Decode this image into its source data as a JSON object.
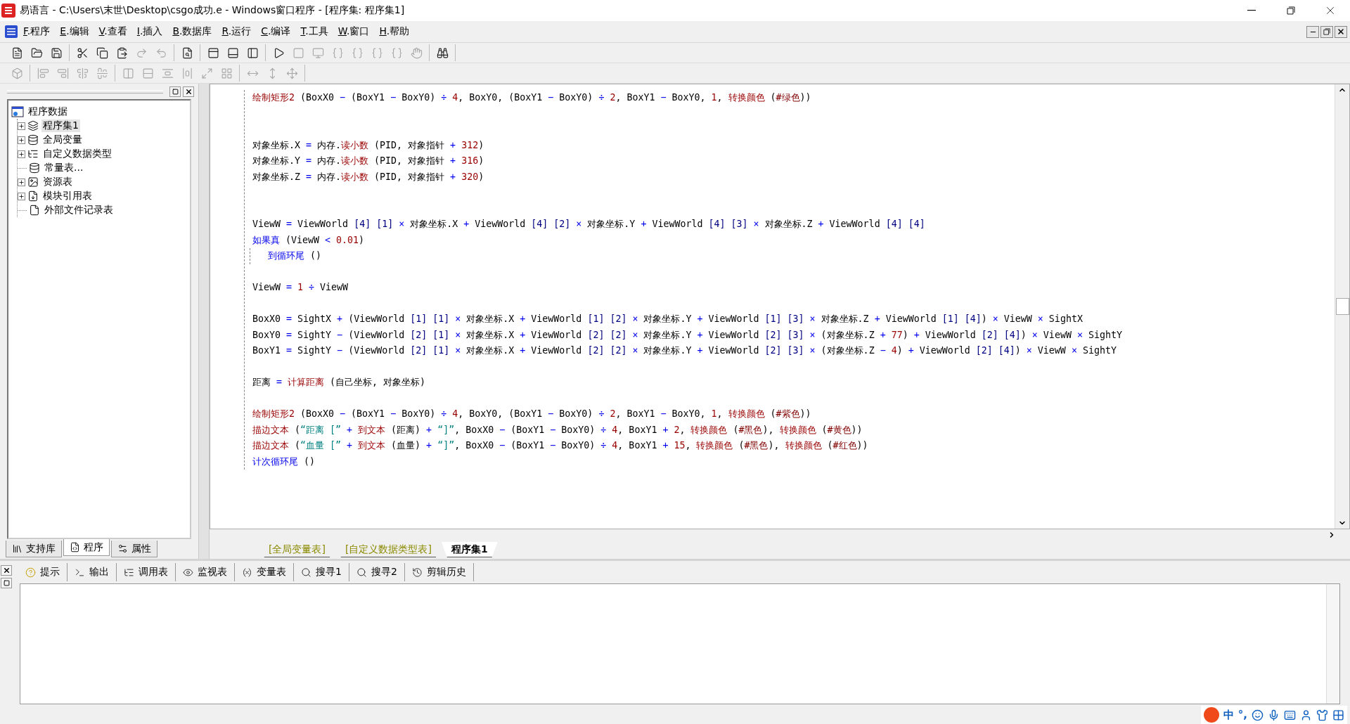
{
  "window": {
    "title": "易语言 - C:\\Users\\末世\\Desktop\\csgo成功.e - Windows窗口程序 - [程序集: 程序集1]"
  },
  "menu": [
    {
      "label": "F.程序"
    },
    {
      "label": "E.编辑"
    },
    {
      "label": "V.查看"
    },
    {
      "label": "I.插入"
    },
    {
      "label": "B.数据库"
    },
    {
      "label": "R.运行"
    },
    {
      "label": "C.编译"
    },
    {
      "label": "T.工具"
    },
    {
      "label": "W.窗口"
    },
    {
      "label": "H.帮助"
    }
  ],
  "toolbar_1": [
    {
      "buttons": [
        {
          "disabled": false
        },
        {
          "disabled": false
        },
        {
          "disabled": false
        }
      ]
    },
    {
      "buttons": [
        {
          "disabled": false
        },
        {
          "disabled": false
        },
        {
          "disabled": false
        },
        {
          "disabled": true
        },
        {
          "disabled": true
        }
      ]
    },
    {
      "buttons": [
        {
          "disabled": false
        }
      ]
    },
    {
      "buttons": [
        {
          "disabled": false
        },
        {
          "disabled": false
        },
        {
          "disabled": false
        }
      ]
    },
    {
      "buttons": [
        {
          "disabled": false
        },
        {
          "disabled": true
        },
        {
          "disabled": true
        },
        {
          "disabled": true
        },
        {
          "disabled": true
        },
        {
          "disabled": true
        },
        {
          "disabled": true
        },
        {
          "disabled": true
        }
      ]
    },
    {
      "buttons": [
        {
          "disabled": false
        }
      ]
    }
  ],
  "toolbar_2": [
    {
      "buttons": [
        {
          "disabled": true
        }
      ]
    },
    {
      "buttons": [
        {
          "disabled": true
        },
        {
          "disabled": true
        },
        {
          "disabled": true
        },
        {
          "disabled": true
        }
      ]
    },
    {
      "buttons": [
        {
          "disabled": true
        },
        {
          "disabled": true
        },
        {
          "disabled": true
        },
        {
          "disabled": true
        },
        {
          "disabled": true
        },
        {
          "disabled": true
        }
      ]
    },
    {
      "buttons": [
        {
          "disabled": true
        },
        {
          "disabled": true
        },
        {
          "disabled": true
        }
      ]
    }
  ],
  "tree": {
    "label": "程序数据",
    "children": [
      {
        "label": "程序集1",
        "expandable": true,
        "selected": true
      },
      {
        "label": "全局变量",
        "expandable": true,
        "selected": false
      },
      {
        "label": "自定义数据类型",
        "expandable": true,
        "selected": false
      },
      {
        "label": "常量表...",
        "expandable": false,
        "selected": false
      },
      {
        "label": "资源表",
        "expandable": true,
        "selected": false
      },
      {
        "label": "模块引用表",
        "expandable": true,
        "selected": false
      },
      {
        "label": "外部文件记录表",
        "expandable": false,
        "selected": false
      }
    ]
  },
  "left_tabs": [
    {
      "label": "支持库",
      "selected": false
    },
    {
      "label": "程序",
      "selected": true
    },
    {
      "label": "属性",
      "selected": false
    }
  ],
  "code": [
    {
      "kind": "code",
      "segs": [
        {
          "kind": "fn",
          "t": "绘制矩形2"
        },
        {
          "kind": "plain",
          "t": " (BoxX0 "
        },
        {
          "kind": "op",
          "t": "−"
        },
        {
          "kind": "plain",
          "t": " (BoxY1 "
        },
        {
          "kind": "op",
          "t": "−"
        },
        {
          "kind": "plain",
          "t": " BoxY0) "
        },
        {
          "kind": "op",
          "t": "÷"
        },
        {
          "kind": "num",
          "t": " 4"
        },
        {
          "kind": "plain",
          "t": ", BoxY0, (BoxY1 "
        },
        {
          "kind": "op",
          "t": "−"
        },
        {
          "kind": "plain",
          "t": " BoxY0) "
        },
        {
          "kind": "op",
          "t": "÷"
        },
        {
          "kind": "num",
          "t": " 2"
        },
        {
          "kind": "plain",
          "t": ", BoxY1 "
        },
        {
          "kind": "op",
          "t": "−"
        },
        {
          "kind": "plain",
          "t": " BoxY0, "
        },
        {
          "kind": "num",
          "t": "1"
        },
        {
          "kind": "plain",
          "t": ", "
        },
        {
          "kind": "fn",
          "t": "转换颜色"
        },
        {
          "kind": "plain",
          "t": " ("
        },
        {
          "kind": "const",
          "t": "#绿色"
        },
        {
          "kind": "plain",
          "t": "))"
        }
      ]
    },
    {
      "kind": "blank"
    },
    {
      "kind": "blank"
    },
    {
      "kind": "code",
      "segs": [
        {
          "kind": "plain",
          "t": "对象坐标.X "
        },
        {
          "kind": "op",
          "t": "="
        },
        {
          "kind": "plain",
          "t": " 内存."
        },
        {
          "kind": "fn",
          "t": "读小数"
        },
        {
          "kind": "plain",
          "t": " (PID, 对象指针 "
        },
        {
          "kind": "op",
          "t": "+"
        },
        {
          "kind": "num",
          "t": " 312"
        },
        {
          "kind": "plain",
          "t": ")"
        }
      ]
    },
    {
      "kind": "code",
      "segs": [
        {
          "kind": "plain",
          "t": "对象坐标.Y "
        },
        {
          "kind": "op",
          "t": "="
        },
        {
          "kind": "plain",
          "t": " 内存."
        },
        {
          "kind": "fn",
          "t": "读小数"
        },
        {
          "kind": "plain",
          "t": " (PID, 对象指针 "
        },
        {
          "kind": "op",
          "t": "+"
        },
        {
          "kind": "num",
          "t": " 316"
        },
        {
          "kind": "plain",
          "t": ")"
        }
      ]
    },
    {
      "kind": "code",
      "segs": [
        {
          "kind": "plain",
          "t": "对象坐标.Z "
        },
        {
          "kind": "op",
          "t": "="
        },
        {
          "kind": "plain",
          "t": " 内存."
        },
        {
          "kind": "fn",
          "t": "读小数"
        },
        {
          "kind": "plain",
          "t": " (PID, 对象指针 "
        },
        {
          "kind": "op",
          "t": "+"
        },
        {
          "kind": "num",
          "t": " 320"
        },
        {
          "kind": "plain",
          "t": ")"
        }
      ]
    },
    {
      "kind": "blank"
    },
    {
      "kind": "blank"
    },
    {
      "kind": "code",
      "segs": [
        {
          "kind": "plain",
          "t": "ViewW "
        },
        {
          "kind": "op",
          "t": "="
        },
        {
          "kind": "plain",
          "t": " ViewWorld "
        },
        {
          "kind": "idx",
          "t": "[4] [1]"
        },
        {
          "kind": "op",
          "t": " ×"
        },
        {
          "kind": "plain",
          "t": " 对象坐标.X "
        },
        {
          "kind": "op",
          "t": "+"
        },
        {
          "kind": "plain",
          "t": " ViewWorld "
        },
        {
          "kind": "idx",
          "t": "[4] [2]"
        },
        {
          "kind": "op",
          "t": " ×"
        },
        {
          "kind": "plain",
          "t": " 对象坐标.Y "
        },
        {
          "kind": "op",
          "t": "+"
        },
        {
          "kind": "plain",
          "t": " ViewWorld "
        },
        {
          "kind": "idx",
          "t": "[4] [3]"
        },
        {
          "kind": "op",
          "t": " ×"
        },
        {
          "kind": "plain",
          "t": " 对象坐标.Z "
        },
        {
          "kind": "op",
          "t": "+"
        },
        {
          "kind": "plain",
          "t": " ViewWorld "
        },
        {
          "kind": "idx",
          "t": "[4] [4]"
        }
      ]
    },
    {
      "kind": "branch",
      "segs": [
        {
          "kind": "kw",
          "t": "如果真"
        },
        {
          "kind": "plain",
          "t": " (ViewW "
        },
        {
          "kind": "op",
          "t": "<"
        },
        {
          "kind": "num",
          "t": " 0.01"
        },
        {
          "kind": "plain",
          "t": ")"
        }
      ],
      "children": [
        {
          "kind": "code",
          "segs": [
            {
              "kind": "kw",
              "t": "到循环尾"
            },
            {
              "kind": "plain",
              "t": " ()"
            }
          ]
        }
      ]
    },
    {
      "kind": "blank"
    },
    {
      "kind": "code",
      "segs": [
        {
          "kind": "plain",
          "t": "ViewW "
        },
        {
          "kind": "op",
          "t": "="
        },
        {
          "kind": "num",
          "t": " 1"
        },
        {
          "kind": "op",
          "t": " ÷"
        },
        {
          "kind": "plain",
          "t": " ViewW"
        }
      ]
    },
    {
      "kind": "blank"
    },
    {
      "kind": "code",
      "segs": [
        {
          "kind": "plain",
          "t": "BoxX0 "
        },
        {
          "kind": "op",
          "t": "="
        },
        {
          "kind": "plain",
          "t": " SightX "
        },
        {
          "kind": "op",
          "t": "+"
        },
        {
          "kind": "plain",
          "t": " (ViewWorld "
        },
        {
          "kind": "idx",
          "t": "[1] [1]"
        },
        {
          "kind": "op",
          "t": " ×"
        },
        {
          "kind": "plain",
          "t": " 对象坐标.X "
        },
        {
          "kind": "op",
          "t": "+"
        },
        {
          "kind": "plain",
          "t": " ViewWorld "
        },
        {
          "kind": "idx",
          "t": "[1] [2]"
        },
        {
          "kind": "op",
          "t": " ×"
        },
        {
          "kind": "plain",
          "t": " 对象坐标.Y "
        },
        {
          "kind": "op",
          "t": "+"
        },
        {
          "kind": "plain",
          "t": " ViewWorld "
        },
        {
          "kind": "idx",
          "t": "[1] [3]"
        },
        {
          "kind": "op",
          "t": " ×"
        },
        {
          "kind": "plain",
          "t": " 对象坐标.Z "
        },
        {
          "kind": "op",
          "t": "+"
        },
        {
          "kind": "plain",
          "t": " ViewWorld "
        },
        {
          "kind": "idx",
          "t": "[1] [4]"
        },
        {
          "kind": "plain",
          "t": ") "
        },
        {
          "kind": "op",
          "t": "×"
        },
        {
          "kind": "plain",
          "t": " ViewW "
        },
        {
          "kind": "op",
          "t": "×"
        },
        {
          "kind": "plain",
          "t": " SightX"
        }
      ]
    },
    {
      "kind": "code",
      "segs": [
        {
          "kind": "plain",
          "t": "BoxY0 "
        },
        {
          "kind": "op",
          "t": "="
        },
        {
          "kind": "plain",
          "t": " SightY "
        },
        {
          "kind": "op",
          "t": "−"
        },
        {
          "kind": "plain",
          "t": " (ViewWorld "
        },
        {
          "kind": "idx",
          "t": "[2] [1]"
        },
        {
          "kind": "op",
          "t": " ×"
        },
        {
          "kind": "plain",
          "t": " 对象坐标.X "
        },
        {
          "kind": "op",
          "t": "+"
        },
        {
          "kind": "plain",
          "t": " ViewWorld "
        },
        {
          "kind": "idx",
          "t": "[2] [2]"
        },
        {
          "kind": "op",
          "t": " ×"
        },
        {
          "kind": "plain",
          "t": " 对象坐标.Y "
        },
        {
          "kind": "op",
          "t": "+"
        },
        {
          "kind": "plain",
          "t": " ViewWorld "
        },
        {
          "kind": "idx",
          "t": "[2] [3]"
        },
        {
          "kind": "op",
          "t": " ×"
        },
        {
          "kind": "plain",
          "t": " (对象坐标.Z "
        },
        {
          "kind": "op",
          "t": "+"
        },
        {
          "kind": "num",
          "t": " 77"
        },
        {
          "kind": "plain",
          "t": ") "
        },
        {
          "kind": "op",
          "t": "+"
        },
        {
          "kind": "plain",
          "t": " ViewWorld "
        },
        {
          "kind": "idx",
          "t": "[2] [4]"
        },
        {
          "kind": "plain",
          "t": ") "
        },
        {
          "kind": "op",
          "t": "×"
        },
        {
          "kind": "plain",
          "t": " ViewW "
        },
        {
          "kind": "op",
          "t": "×"
        },
        {
          "kind": "plain",
          "t": " SightY"
        }
      ]
    },
    {
      "kind": "code",
      "segs": [
        {
          "kind": "plain",
          "t": "BoxY1 "
        },
        {
          "kind": "op",
          "t": "="
        },
        {
          "kind": "plain",
          "t": " SightY "
        },
        {
          "kind": "op",
          "t": "−"
        },
        {
          "kind": "plain",
          "t": " (ViewWorld "
        },
        {
          "kind": "idx",
          "t": "[2] [1]"
        },
        {
          "kind": "op",
          "t": " ×"
        },
        {
          "kind": "plain",
          "t": " 对象坐标.X "
        },
        {
          "kind": "op",
          "t": "+"
        },
        {
          "kind": "plain",
          "t": " ViewWorld "
        },
        {
          "kind": "idx",
          "t": "[2] [2]"
        },
        {
          "kind": "op",
          "t": " ×"
        },
        {
          "kind": "plain",
          "t": " 对象坐标.Y "
        },
        {
          "kind": "op",
          "t": "+"
        },
        {
          "kind": "plain",
          "t": " ViewWorld "
        },
        {
          "kind": "idx",
          "t": "[2] [3]"
        },
        {
          "kind": "op",
          "t": " ×"
        },
        {
          "kind": "plain",
          "t": " (对象坐标.Z "
        },
        {
          "kind": "op",
          "t": "−"
        },
        {
          "kind": "num",
          "t": " 4"
        },
        {
          "kind": "plain",
          "t": ") "
        },
        {
          "kind": "op",
          "t": "+"
        },
        {
          "kind": "plain",
          "t": " ViewWorld "
        },
        {
          "kind": "idx",
          "t": "[2] [4]"
        },
        {
          "kind": "plain",
          "t": ") "
        },
        {
          "kind": "op",
          "t": "×"
        },
        {
          "kind": "plain",
          "t": " ViewW "
        },
        {
          "kind": "op",
          "t": "×"
        },
        {
          "kind": "plain",
          "t": " SightY"
        }
      ]
    },
    {
      "kind": "blank"
    },
    {
      "kind": "code",
      "segs": [
        {
          "kind": "plain",
          "t": "距离 "
        },
        {
          "kind": "op",
          "t": "="
        },
        {
          "kind": "fn",
          "t": " 计算距离"
        },
        {
          "kind": "plain",
          "t": " (自己坐标, 对象坐标)"
        }
      ]
    },
    {
      "kind": "blank"
    },
    {
      "kind": "code",
      "segs": [
        {
          "kind": "fn",
          "t": "绘制矩形2"
        },
        {
          "kind": "plain",
          "t": " (BoxX0 "
        },
        {
          "kind": "op",
          "t": "−"
        },
        {
          "kind": "plain",
          "t": " (BoxY1 "
        },
        {
          "kind": "op",
          "t": "−"
        },
        {
          "kind": "plain",
          "t": " BoxY0) "
        },
        {
          "kind": "op",
          "t": "÷"
        },
        {
          "kind": "num",
          "t": " 4"
        },
        {
          "kind": "plain",
          "t": ", BoxY0, (BoxY1 "
        },
        {
          "kind": "op",
          "t": "−"
        },
        {
          "kind": "plain",
          "t": " BoxY0) "
        },
        {
          "kind": "op",
          "t": "÷"
        },
        {
          "kind": "num",
          "t": " 2"
        },
        {
          "kind": "plain",
          "t": ", BoxY1 "
        },
        {
          "kind": "op",
          "t": "−"
        },
        {
          "kind": "plain",
          "t": " BoxY0, "
        },
        {
          "kind": "num",
          "t": "1"
        },
        {
          "kind": "plain",
          "t": ", "
        },
        {
          "kind": "fn",
          "t": "转换颜色"
        },
        {
          "kind": "plain",
          "t": " ("
        },
        {
          "kind": "const",
          "t": "#紫色"
        },
        {
          "kind": "plain",
          "t": "))"
        }
      ]
    },
    {
      "kind": "code",
      "segs": [
        {
          "kind": "fn",
          "t": "描边文本"
        },
        {
          "kind": "plain",
          "t": " ("
        },
        {
          "kind": "str",
          "t": "“距离 [”"
        },
        {
          "kind": "op",
          "t": " +"
        },
        {
          "kind": "fn",
          "t": " 到文本"
        },
        {
          "kind": "plain",
          "t": " (距离) "
        },
        {
          "kind": "op",
          "t": "+"
        },
        {
          "kind": "str",
          "t": " “]”"
        },
        {
          "kind": "plain",
          "t": ", BoxX0 "
        },
        {
          "kind": "op",
          "t": "−"
        },
        {
          "kind": "plain",
          "t": " (BoxY1 "
        },
        {
          "kind": "op",
          "t": "−"
        },
        {
          "kind": "plain",
          "t": " BoxY0) "
        },
        {
          "kind": "op",
          "t": "÷"
        },
        {
          "kind": "num",
          "t": " 4"
        },
        {
          "kind": "plain",
          "t": ", BoxY1 "
        },
        {
          "kind": "op",
          "t": "+"
        },
        {
          "kind": "num",
          "t": " 2"
        },
        {
          "kind": "plain",
          "t": ", "
        },
        {
          "kind": "fn",
          "t": "转换颜色"
        },
        {
          "kind": "plain",
          "t": " ("
        },
        {
          "kind": "const",
          "t": "#黑色"
        },
        {
          "kind": "plain",
          "t": "), "
        },
        {
          "kind": "fn",
          "t": "转换颜色"
        },
        {
          "kind": "plain",
          "t": " ("
        },
        {
          "kind": "const",
          "t": "#黄色"
        },
        {
          "kind": "plain",
          "t": "))"
        }
      ]
    },
    {
      "kind": "code",
      "segs": [
        {
          "kind": "fn",
          "t": "描边文本"
        },
        {
          "kind": "plain",
          "t": " ("
        },
        {
          "kind": "str",
          "t": "“血量 [”"
        },
        {
          "kind": "op",
          "t": " +"
        },
        {
          "kind": "fn",
          "t": " 到文本"
        },
        {
          "kind": "plain",
          "t": " (血量) "
        },
        {
          "kind": "op",
          "t": "+"
        },
        {
          "kind": "str",
          "t": " “]”"
        },
        {
          "kind": "plain",
          "t": ", BoxX0 "
        },
        {
          "kind": "op",
          "t": "−"
        },
        {
          "kind": "plain",
          "t": " (BoxY1 "
        },
        {
          "kind": "op",
          "t": "−"
        },
        {
          "kind": "plain",
          "t": " BoxY0) "
        },
        {
          "kind": "op",
          "t": "÷"
        },
        {
          "kind": "num",
          "t": " 4"
        },
        {
          "kind": "plain",
          "t": ", BoxY1 "
        },
        {
          "kind": "op",
          "t": "+"
        },
        {
          "kind": "num",
          "t": " 15"
        },
        {
          "kind": "plain",
          "t": ", "
        },
        {
          "kind": "fn",
          "t": "转换颜色"
        },
        {
          "kind": "plain",
          "t": " ("
        },
        {
          "kind": "const",
          "t": "#黑色"
        },
        {
          "kind": "plain",
          "t": "), "
        },
        {
          "kind": "fn",
          "t": "转换颜色"
        },
        {
          "kind": "plain",
          "t": " ("
        },
        {
          "kind": "const",
          "t": "#红色"
        },
        {
          "kind": "plain",
          "t": "))"
        }
      ]
    }
  ],
  "loop_end": {
    "segs": [
      {
        "kind": "kw",
        "t": "计次循环尾"
      },
      {
        "kind": "plain",
        "t": " ()"
      }
    ]
  },
  "editor_tabs": [
    {
      "label": "[全局变量表]",
      "selected": false
    },
    {
      "label": "[自定义数据类型表]",
      "selected": false
    },
    {
      "label": "程序集1",
      "selected": true
    }
  ],
  "bottom_tabs": [
    {
      "label": "提示"
    },
    {
      "label": "输出"
    },
    {
      "label": "调用表"
    },
    {
      "label": "监视表"
    },
    {
      "label": "变量表"
    },
    {
      "label": "搜寻1"
    },
    {
      "label": "搜寻2"
    },
    {
      "label": "剪辑历史"
    }
  ],
  "ime": {
    "mode": "中",
    "punct": "°,"
  }
}
